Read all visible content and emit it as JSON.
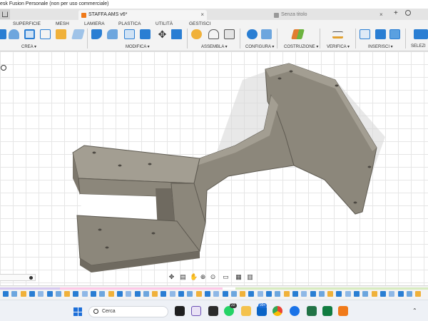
{
  "window": {
    "title": "esk Fusion Personale (non per uso commerciale)"
  },
  "tabs": [
    {
      "label": "STAFFA AMS v6*",
      "close": "×",
      "active": true
    },
    {
      "label": "Senza titolo",
      "close": "×",
      "active": false
    }
  ],
  "tab_add": "+",
  "workspace_tabs": [
    "SUPERFICIE",
    "MESH",
    "LAMIERA",
    "PLASTICA",
    "UTILITÀ",
    "GESTISCI"
  ],
  "toolbar_groups": [
    {
      "label": "CREA ▾"
    },
    {
      "label": "MODIFICA ▾"
    },
    {
      "label": "ASSEMBLA ▾"
    },
    {
      "label": "CONFIGURA ▾"
    },
    {
      "label": "COSTRUZIONE ▾"
    },
    {
      "label": "VERIFICA ▾"
    },
    {
      "label": "INSERISCI ▾"
    },
    {
      "label": "SELEZI"
    }
  ],
  "taskbar": {
    "search_placeholder": "Cerca",
    "whatsapp_badge": "22",
    "outlook_badge": "99+"
  },
  "colors": {
    "accent": "#1a73c8",
    "part_fill": "#8c877b",
    "part_edge": "#5e5a51",
    "part_top": "#a39e92",
    "viewport_grid": "#e6e6e6",
    "tab_dot": "#f07a1a"
  },
  "icons": {
    "home": "home-icon",
    "start": "windows-start-icon",
    "search": "search-icon"
  }
}
